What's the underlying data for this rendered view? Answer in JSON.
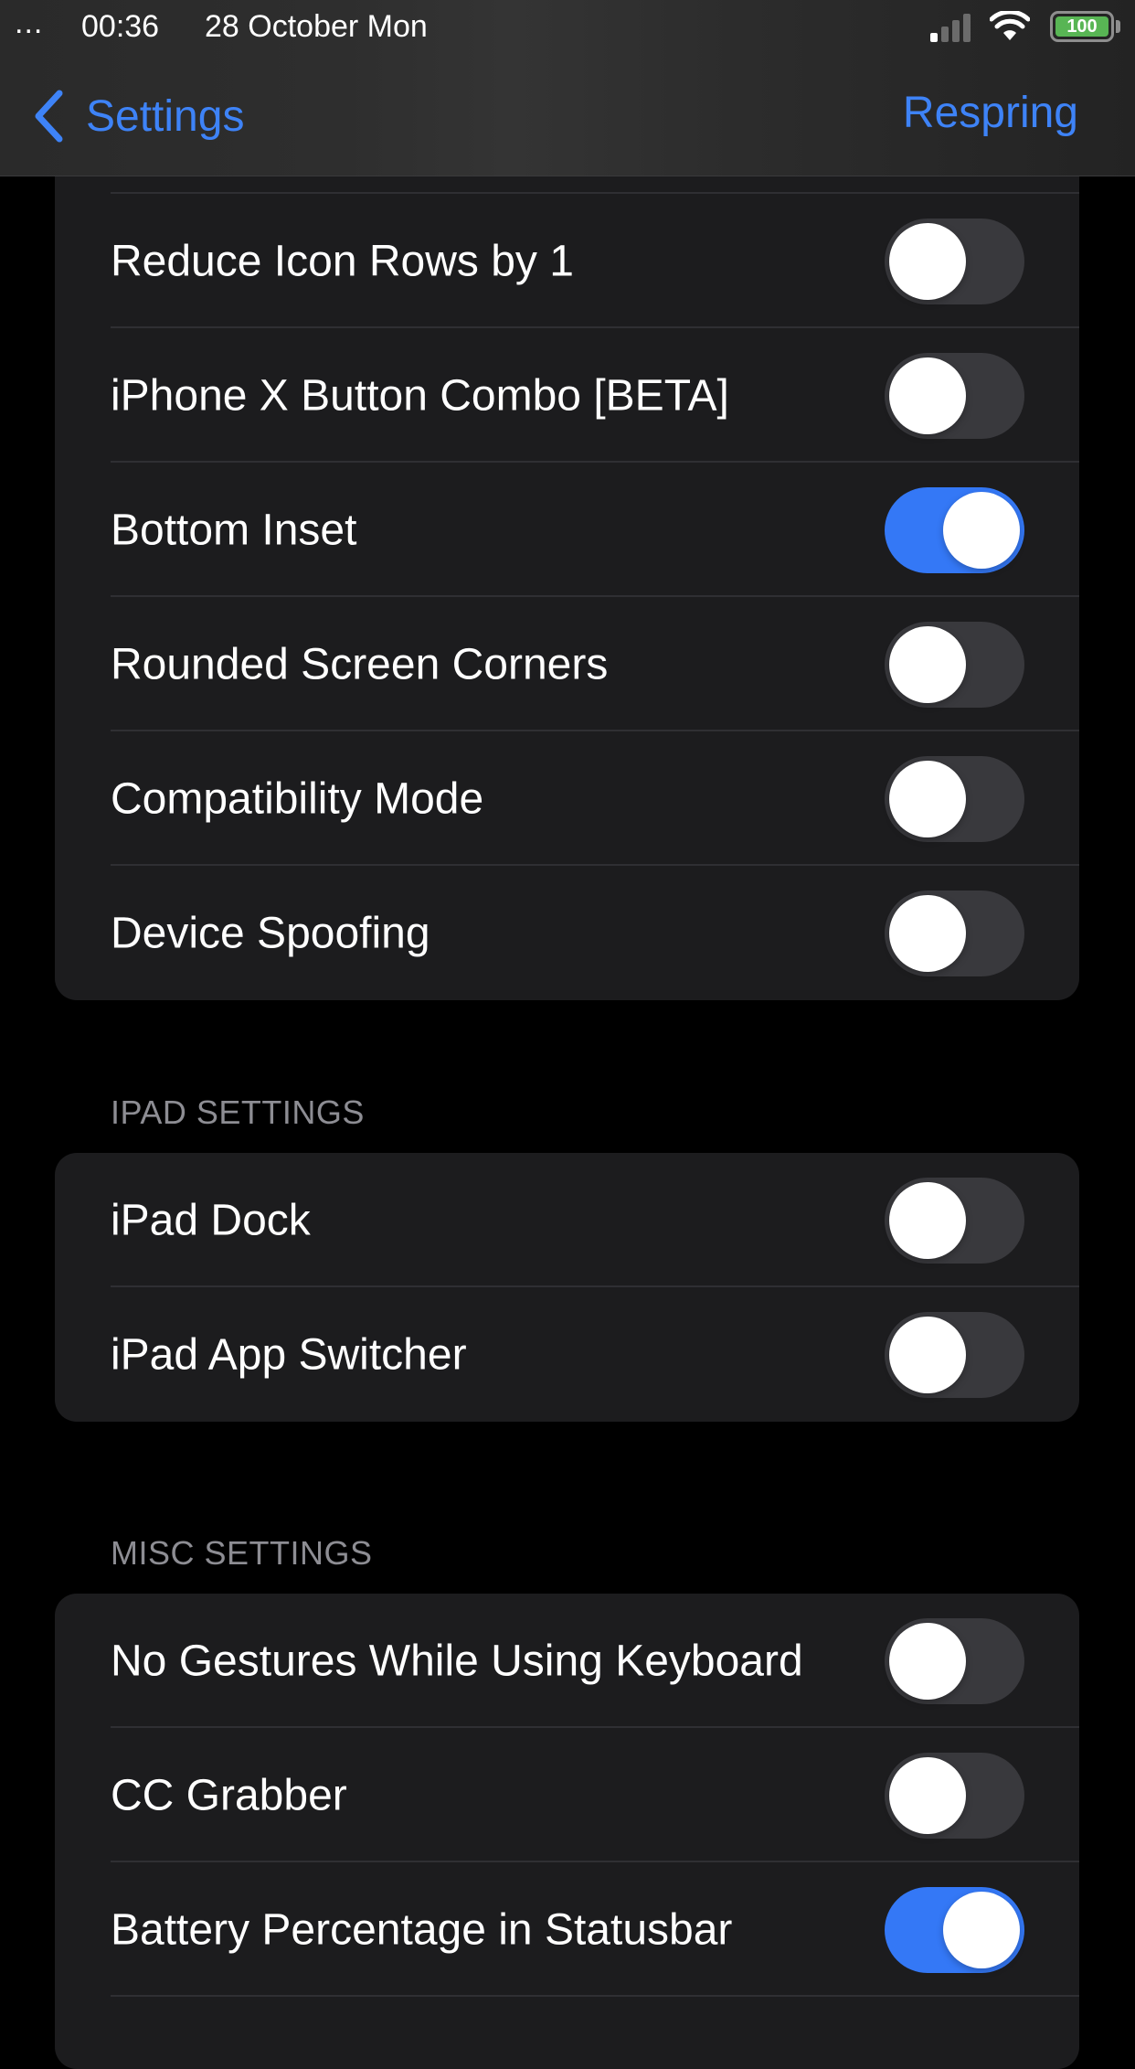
{
  "status_bar": {
    "dots": "...",
    "time": "00:36",
    "date": "28 October Mon",
    "battery": "100",
    "icons": [
      "signal-icon",
      "wifi-icon",
      "battery-icon"
    ]
  },
  "nav": {
    "back_label": "Settings",
    "action_label": "Respring",
    "accent_color": "#3e83f7"
  },
  "groups": {
    "top": {
      "rows": [
        {
          "label": "Reduce Icon Rows by 1",
          "on": false
        },
        {
          "label": "iPhone X Button Combo [BETA]",
          "on": false
        },
        {
          "label": "Bottom Inset",
          "on": true
        },
        {
          "label": "Rounded Screen Corners",
          "on": false
        },
        {
          "label": "Compatibility Mode",
          "on": false
        },
        {
          "label": "Device Spoofing",
          "on": false
        }
      ]
    },
    "ipad": {
      "header": "IPAD SETTINGS",
      "rows": [
        {
          "label": "iPad Dock",
          "on": false
        },
        {
          "label": "iPad App Switcher",
          "on": false
        }
      ]
    },
    "misc": {
      "header": "MISC SETTINGS",
      "rows": [
        {
          "label": "No Gestures While Using Keyboard",
          "on": false
        },
        {
          "label": "CC Grabber",
          "on": false
        },
        {
          "label": "Battery Percentage in Statusbar",
          "on": true
        }
      ]
    }
  },
  "colors": {
    "toggle_on": "#3478f6",
    "toggle_off": "#39393d",
    "cell_background": "#1c1c1e",
    "page_background": "#000000"
  }
}
